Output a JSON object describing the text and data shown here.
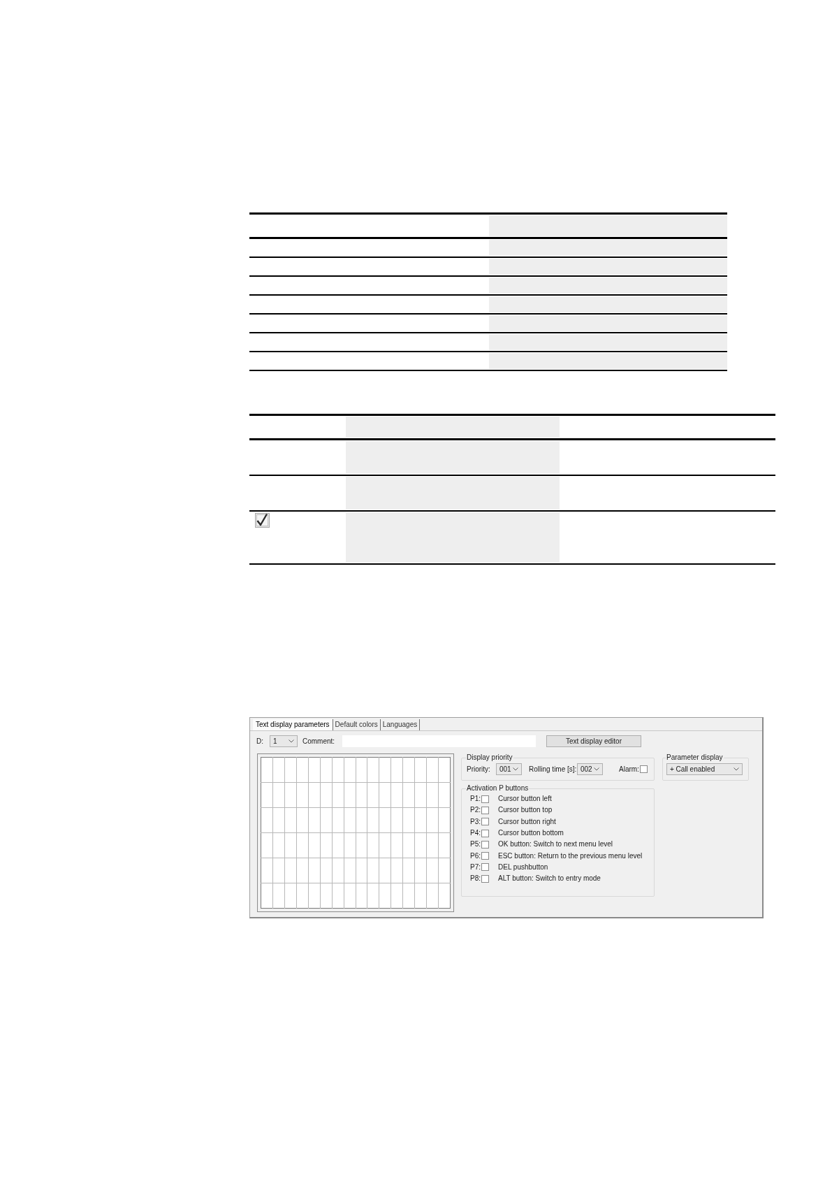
{
  "tables": [
    {
      "columns": [
        {
          "kind": "plain"
        },
        {
          "kind": "shaded"
        }
      ],
      "rows": [
        {
          "kind": "header"
        },
        {
          "kind": "body"
        },
        {
          "kind": "body"
        },
        {
          "kind": "body"
        },
        {
          "kind": "body"
        },
        {
          "kind": "body"
        },
        {
          "kind": "body"
        },
        {
          "kind": "body"
        }
      ]
    },
    {
      "columns": [
        {
          "kind": "plain"
        },
        {
          "kind": "shaded"
        },
        {
          "kind": "plain"
        }
      ],
      "rows": [
        {
          "kind": "header"
        },
        {
          "kind": "body"
        },
        {
          "kind": "body"
        },
        {
          "kind": "body",
          "checkbox": {
            "checked": true
          }
        }
      ]
    }
  ],
  "dialog": {
    "tabs": [
      {
        "label": "Text display parameters",
        "selected": true
      },
      {
        "label": "Default colors",
        "selected": false
      },
      {
        "label": "Languages",
        "selected": false
      }
    ],
    "d": {
      "label": "D:",
      "value": "1"
    },
    "comment": {
      "label": "Comment:"
    },
    "editor_button": {
      "label": "Text display editor"
    },
    "display_priority": {
      "title": "Display priority",
      "priority": {
        "label": "Priority:",
        "value": "001"
      },
      "rolling_time": {
        "label": "Rolling time [s]:",
        "value": "002"
      },
      "alarm": {
        "label": "Alarm:",
        "checked": false
      }
    },
    "parameter_display": {
      "title": "Parameter display",
      "value": "+ Call enabled"
    },
    "p_buttons": {
      "title": "Activation P buttons",
      "items": [
        {
          "label": "P1:",
          "checked": false,
          "text": "Cursor button left"
        },
        {
          "label": "P2:",
          "checked": false,
          "text": "Cursor button top"
        },
        {
          "label": "P3:",
          "checked": false,
          "text": "Cursor button right"
        },
        {
          "label": "P4:",
          "checked": false,
          "text": "Cursor button bottom"
        },
        {
          "label": "P5:",
          "checked": false,
          "text": "OK button: Switch to next menu level"
        },
        {
          "label": "P6:",
          "checked": false,
          "text": "ESC button: Return to the previous menu level"
        },
        {
          "label": "P7:",
          "checked": false,
          "text": "DEL pushbutton"
        },
        {
          "label": "P8:",
          "checked": false,
          "text": "ALT button: Switch to entry mode"
        }
      ]
    }
  }
}
